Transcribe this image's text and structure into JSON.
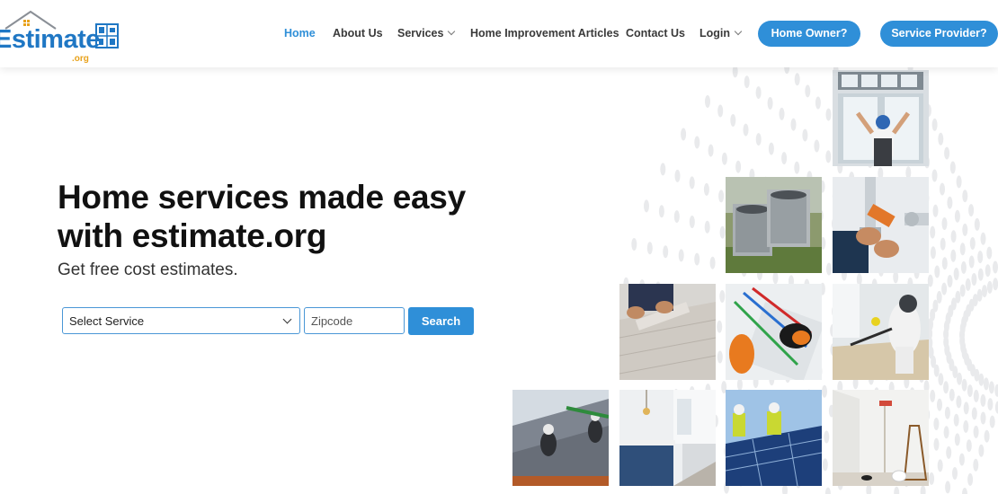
{
  "logo": {
    "text": "Estimate",
    "suffix": ".org"
  },
  "nav": {
    "items": [
      {
        "label": "Home",
        "active": true
      },
      {
        "label": "About Us"
      },
      {
        "label": "Services",
        "dropdown": true
      },
      {
        "label": "Home Improvement Articles"
      },
      {
        "label": "Contact Us"
      },
      {
        "label": "Login",
        "dropdown": true
      }
    ],
    "home_owner_label": "Home Owner?",
    "service_provider_label": "Service Provider?"
  },
  "hero": {
    "title_line1": "Home services made easy",
    "title_line2": "with estimate.org",
    "subtitle": "Get free cost estimates."
  },
  "search": {
    "select_value": "Select Service",
    "zip_placeholder": "Zipcode",
    "button_label": "Search"
  },
  "colors": {
    "brand": "#2f8fd8",
    "logo_blue": "#1f77c4",
    "logo_orange": "#e8a21c"
  },
  "tiles": [
    "window-installer-photo",
    "ac-units-photo",
    "plumber-pipe-photo",
    "flooring-install-photo",
    "electrician-wiring-photo",
    "pest-control-photo",
    "roofer-photo",
    "kitchen-photo",
    "solar-panel-installers-photo",
    "painting-room-photo"
  ]
}
